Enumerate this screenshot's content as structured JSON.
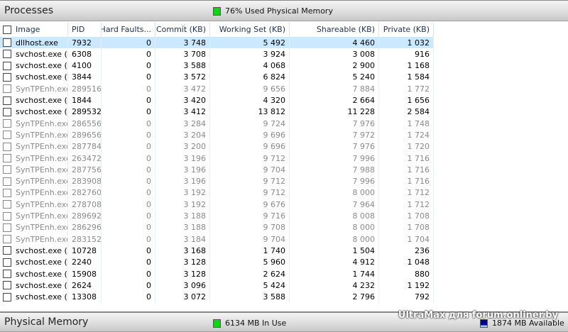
{
  "processes": {
    "title": "Processes",
    "stat": "76% Used Physical Memory",
    "stat_color": "#00e000"
  },
  "columns": [
    "Image",
    "PID",
    "Hard Faults...",
    "Commit (KB)",
    "Working Set (KB)",
    "Shareable (KB)",
    "Private (KB)"
  ],
  "rows": [
    [
      "dllhost.exe",
      "7932",
      "0",
      "3 748",
      "5 492",
      "4 460",
      "1 032"
    ],
    [
      "svchost.exe (...",
      "6308",
      "0",
      "3 708",
      "3 924",
      "3 008",
      "916"
    ],
    [
      "svchost.exe (...",
      "4100",
      "0",
      "3 588",
      "4 068",
      "2 900",
      "1 168"
    ],
    [
      "svchost.exe (...",
      "3844",
      "0",
      "3 572",
      "6 824",
      "5 240",
      "1 584"
    ],
    [
      "SynTPEnh.exe",
      "289516",
      "0",
      "3 472",
      "9 656",
      "7 884",
      "1 772"
    ],
    [
      "svchost.exe (...",
      "1844",
      "0",
      "3 420",
      "4 320",
      "2 664",
      "1 656"
    ],
    [
      "svchost.exe (...",
      "289532",
      "0",
      "3 412",
      "13 812",
      "11 228",
      "2 584"
    ],
    [
      "SynTPEnh.exe",
      "286556",
      "0",
      "3 284",
      "9 724",
      "7 976",
      "1 748"
    ],
    [
      "SynTPEnh.exe",
      "289656",
      "0",
      "3 204",
      "9 696",
      "7 972",
      "1 724"
    ],
    [
      "SynTPEnh.exe",
      "287784",
      "0",
      "3 200",
      "9 696",
      "7 976",
      "1 720"
    ],
    [
      "SynTPEnh.exe",
      "263472",
      "0",
      "3 196",
      "9 712",
      "7 996",
      "1 716"
    ],
    [
      "SynTPEnh.exe",
      "287756",
      "0",
      "3 196",
      "9 704",
      "7 988",
      "1 716"
    ],
    [
      "SynTPEnh.exe",
      "283908",
      "0",
      "3 196",
      "9 712",
      "7 996",
      "1 716"
    ],
    [
      "SynTPEnh.exe",
      "282760",
      "0",
      "3 192",
      "9 712",
      "8 000",
      "1 712"
    ],
    [
      "SynTPEnh.exe",
      "278708",
      "0",
      "3 192",
      "9 676",
      "7 964",
      "1 712"
    ],
    [
      "SynTPEnh.exe",
      "289692",
      "0",
      "3 188",
      "9 716",
      "8 008",
      "1 708"
    ],
    [
      "SynTPEnh.exe",
      "286296",
      "0",
      "3 188",
      "9 708",
      "8 000",
      "1 708"
    ],
    [
      "SynTPEnh.exe",
      "283152",
      "0",
      "3 184",
      "9 704",
      "8 000",
      "1 704"
    ],
    [
      "svchost.exe (...",
      "10728",
      "0",
      "3 168",
      "1 740",
      "1 504",
      "236"
    ],
    [
      "svchost.exe (...",
      "2240",
      "0",
      "3 128",
      "5 960",
      "4 912",
      "1 048"
    ],
    [
      "svchost.exe (...",
      "15908",
      "0",
      "3 128",
      "2 624",
      "1 744",
      "880"
    ],
    [
      "svchost.exe (...",
      "2624",
      "0",
      "3 096",
      "5 424",
      "4 232",
      "1 192"
    ],
    [
      "svchost.exe (...",
      "13308",
      "0",
      "3 072",
      "3 588",
      "2 796",
      "792"
    ]
  ],
  "dimmed_rows": [
    4,
    7,
    8,
    9,
    10,
    11,
    12,
    13,
    14,
    15,
    16,
    17
  ],
  "selected_row": 0,
  "physical": {
    "title": "Physical Memory",
    "in_use": "6134 MB In Use",
    "in_use_color": "#00e000",
    "available": "1874 MB Available",
    "available_color": "#0000a0"
  },
  "watermark": "UltraMax для forum.onliner.by"
}
